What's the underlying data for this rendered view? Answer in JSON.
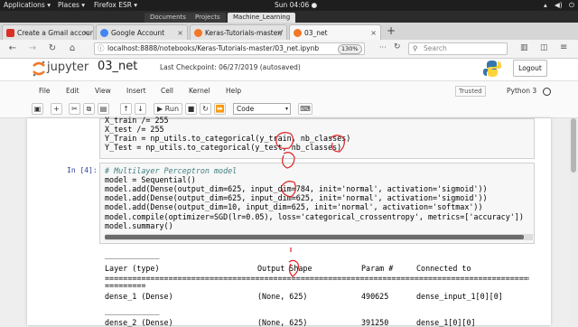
{
  "topbar": {
    "applications": "Applications ▾",
    "places": "Places ▾",
    "browser": "Firefox ESR ▾",
    "clock": "Sun 04:06 ●"
  },
  "window_tabs": [
    "Documents",
    "Projects",
    "Machine_Learning"
  ],
  "browser_tabs": [
    {
      "label": "Create a Gmail account",
      "color": "#d93025"
    },
    {
      "label": "Google Account",
      "color": "#4285f4"
    },
    {
      "label": "Keras-Tutorials-master/",
      "color": "#f37726"
    },
    {
      "label": "03_net",
      "color": "#f37726"
    }
  ],
  "nav": {
    "url": "localhost:8888/notebooks/Keras-Tutorials-master/03_net.ipynb",
    "zoom": "130%",
    "search_placeholder": "Search"
  },
  "jupyter": {
    "logo": "jupyter",
    "notebook_name": "03_net",
    "checkpoint": "Last Checkpoint: 06/27/2019  (autosaved)",
    "logout": "Logout",
    "menus": [
      "File",
      "Edit",
      "View",
      "Insert",
      "Cell",
      "Kernel",
      "Help"
    ],
    "trusted": "Trusted",
    "kernel": "Python 3",
    "run_label": "Run",
    "cell_type": "Code"
  },
  "cell3": {
    "lines": [
      "X_train /= 255",
      "X_test /= 255",
      "Y_Train = np_utils.to_categorical(y_train, nb_classes)",
      "Y_Test = np_utils.to_categorical(y_test, nb_classes)"
    ]
  },
  "cell4": {
    "prompt": "In [4]:",
    "comment": "# Multilayer Perceptron model",
    "lines": [
      "model = Sequential()",
      "model.add(Dense(output_dim=625, input_dim=784, init='normal', activation='sigmoid'))",
      "model.add(Dense(output_dim=625, input_dim=625, init='normal', activation='sigmoid'))",
      "model.add(Dense(output_dim=10, input_dim=625, init='normal', activation='softmax'))",
      "model.compile(optimizer=SGD(lr=0.05), loss='categorical_crossentropy', metrics=['accuracy'])",
      "model.summary()"
    ]
  },
  "summary": {
    "rule_top": "____________",
    "headers": [
      "Layer (type)",
      "Output Shape",
      "Param #",
      "Connected to"
    ],
    "rule_eq": "================================================================================================",
    "rule_eq2": "=========",
    "rows": [
      [
        "dense_1 (Dense)",
        "(None, 625)",
        "490625",
        "dense_input_1[0][0]"
      ],
      [
        "dense_2 (Dense)",
        "(None, 625)",
        "391250",
        "dense_1[0][0]"
      ]
    ]
  }
}
